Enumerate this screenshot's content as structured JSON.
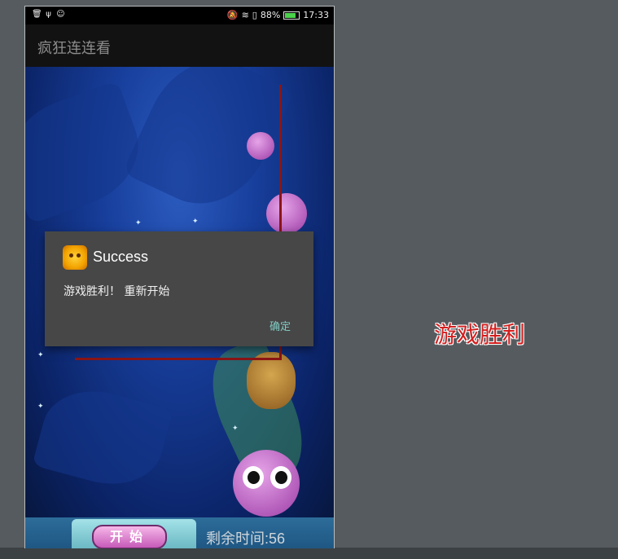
{
  "status_bar": {
    "battery": "88%",
    "time": "17:33",
    "battery_level": 0.88
  },
  "app": {
    "title": "疯狂连连看"
  },
  "dialog": {
    "title": "Success",
    "message": "游戏胜利！ 重新开始",
    "confirm_label": "确定"
  },
  "bottom_panel": {
    "start_label": "开始",
    "remaining_time": "剩余时间:56"
  },
  "caption": "游戏胜利",
  "colors": {
    "path_line": "#8b1515",
    "caption": "#d31e1e",
    "dialog_button": "#80cbc4"
  }
}
